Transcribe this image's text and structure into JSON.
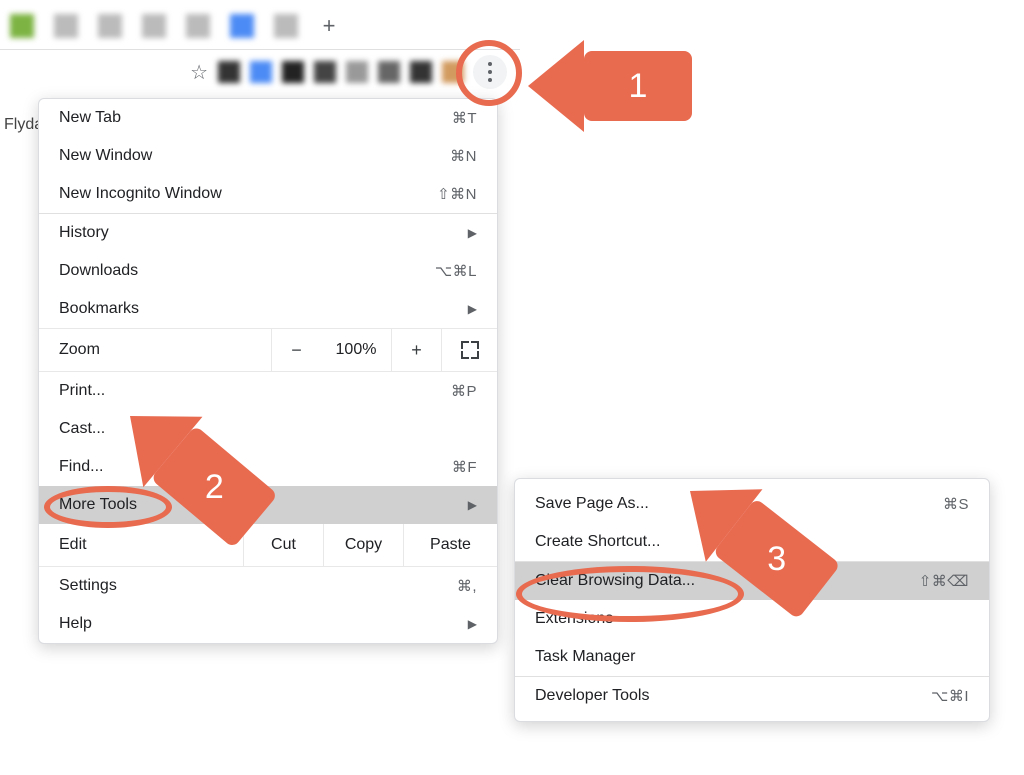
{
  "background": {
    "side_text": "Flyda"
  },
  "toolbar": {
    "new_tab_plus": "+"
  },
  "menu": {
    "items": {
      "new_tab": {
        "label": "New Tab",
        "shortcut": "⌘T"
      },
      "new_window": {
        "label": "New Window",
        "shortcut": "⌘N"
      },
      "new_incognito": {
        "label": "New Incognito Window",
        "shortcut": "⇧⌘N"
      },
      "history": {
        "label": "History"
      },
      "downloads": {
        "label": "Downloads",
        "shortcut": "⌥⌘L"
      },
      "bookmarks": {
        "label": "Bookmarks"
      },
      "zoom": {
        "label": "Zoom",
        "value": "100%",
        "minus": "−",
        "plus": "+"
      },
      "print": {
        "label": "Print...",
        "shortcut": "⌘P"
      },
      "cast": {
        "label": "Cast..."
      },
      "find": {
        "label": "Find...",
        "shortcut": "⌘F"
      },
      "more_tools": {
        "label": "More Tools"
      },
      "edit": {
        "label": "Edit",
        "cut": "Cut",
        "copy": "Copy",
        "paste": "Paste"
      },
      "settings": {
        "label": "Settings",
        "shortcut": "⌘,"
      },
      "help": {
        "label": "Help"
      }
    }
  },
  "submenu": {
    "items": {
      "save_page": {
        "label": "Save Page As...",
        "shortcut": "⌘S"
      },
      "create_shortcut": {
        "label": "Create Shortcut..."
      },
      "clear_data": {
        "label": "Clear Browsing Data...",
        "shortcut": "⇧⌘⌫"
      },
      "extensions": {
        "label": "Extensions"
      },
      "task_manager": {
        "label": "Task Manager"
      },
      "dev_tools": {
        "label": "Developer Tools",
        "shortcut": "⌥⌘I"
      }
    }
  },
  "annotations": {
    "step1": "1",
    "step2": "2",
    "step3": "3"
  }
}
